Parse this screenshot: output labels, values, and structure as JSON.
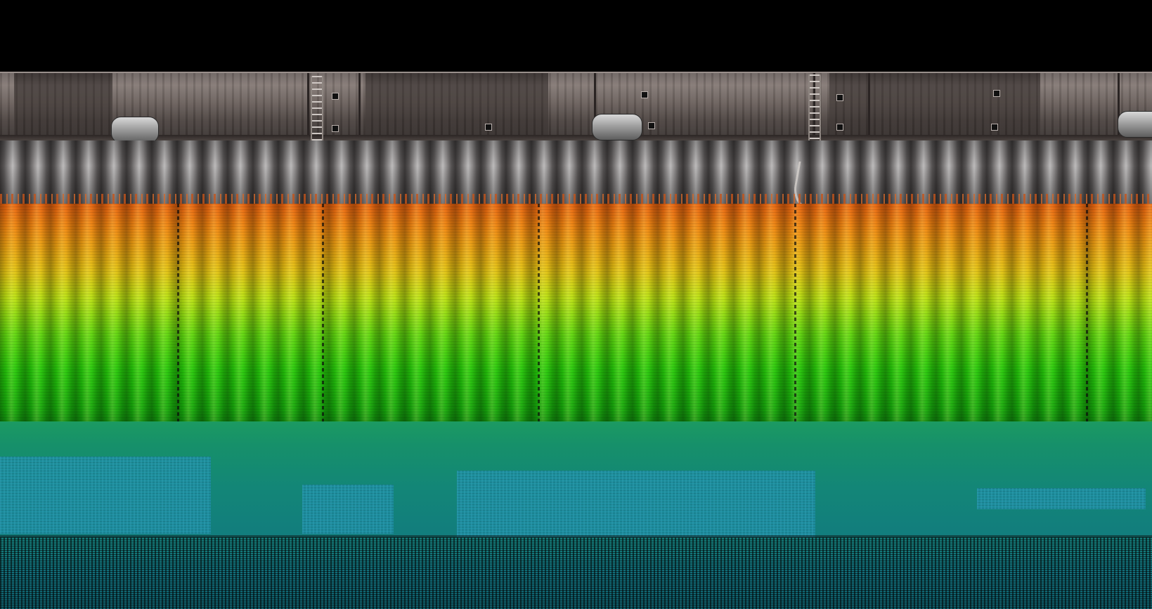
{
  "scene": {
    "kind": "point-cloud quay wall survey",
    "colors": {
      "background": "#000000",
      "concrete": "#6e6562",
      "waterline": "#c4541b",
      "depth_shallow": "#e8620f",
      "depth_mid": "#e2c112",
      "depth_deep": "#24c90a",
      "seabed": "#138677",
      "seabed_far": "#0f5e6a"
    }
  }
}
